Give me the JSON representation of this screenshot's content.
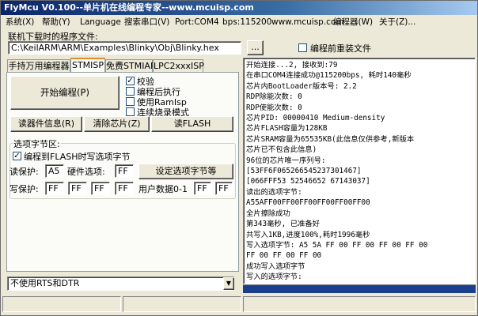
{
  "title": "FlyMcu V0.100--单片机在线编程专家--www.mcuisp.com",
  "menu": [
    "系统(X)",
    "帮助(Y)",
    "Language",
    "搜索串口(V)",
    "Port:COM4",
    "bps:115200",
    "www.mcuisp.com",
    "编程器(W)",
    "关于(Z)..."
  ],
  "file_section": {
    "label": "联机下载时的程序文件:",
    "path": "C:\\KeilARM\\ARM\\Examples\\Blinky\\Obj\\Blinky.hex",
    "browse_label": "...",
    "reload_label": "编程前重装文件"
  },
  "tabs": [
    "手持万用编程器",
    "STMISP",
    "免费STMIAP",
    "LPC2xxxISP"
  ],
  "options": {
    "verify": "校验",
    "run_after": "编程后执行",
    "use_ramisp": "使用RamIsp",
    "continuous": "连续烧录模式"
  },
  "buttons": {
    "start": "开始编程(P)",
    "read_info": "读器件信息(R)",
    "clear_chip": "清除芯片(Z)",
    "read_flash": "读FLASH",
    "set_options": "设定选项字节等"
  },
  "option_bytes": {
    "group_label": "选项字节区:",
    "write_on_flash": "编程到FLASH时写选项字节",
    "read_protect_label": "读保护:",
    "read_protect_value": "A5",
    "hw_option_label": "硬件选项:",
    "hw_option_value": "FF",
    "write_protect_label": "写保护:",
    "write_protect_values": [
      "FF",
      "FF",
      "FF",
      "FF"
    ],
    "user_data_label": "用户数据0-1",
    "user_data_values": [
      "FF",
      "FF"
    ]
  },
  "rts_dtr": {
    "selected": "不使用RTS和DTR"
  },
  "log_lines": [
    "开始连接...2, 接收到:79",
    "在串口COM4连接成功@115200bps, 耗时140毫秒",
    "芯片内BootLoader版本号: 2.2",
    "RDP除能次数: 0",
    "RDP使能次数: 0",
    "芯片PID: 00000410  Medium-density",
    "芯片FLASH容量为128KB",
    "芯片SRAM容量为65535KB(此信息仅供参考,新版本",
    "芯片已不包含此信息)",
    "96位的芯片唯一序列号:",
    "[53FF6F065266545237301467]",
    "[066FFF53 52546652 67143037]",
    "读出的选项字节:",
    "A55AFF00FF00FF00FF00FF00FF00",
    "全片擦除成功",
    "第343毫秒, 已准备好",
    "共写入1KB,进度100%,耗时1996毫秒",
    "写入选项字节:  A5 5A FF 00 FF 00 FF 00 FF 00",
    "FF 00 FF 00 FF 00",
    "成功写入选项字节",
    "写入的选项字节:"
  ]
}
